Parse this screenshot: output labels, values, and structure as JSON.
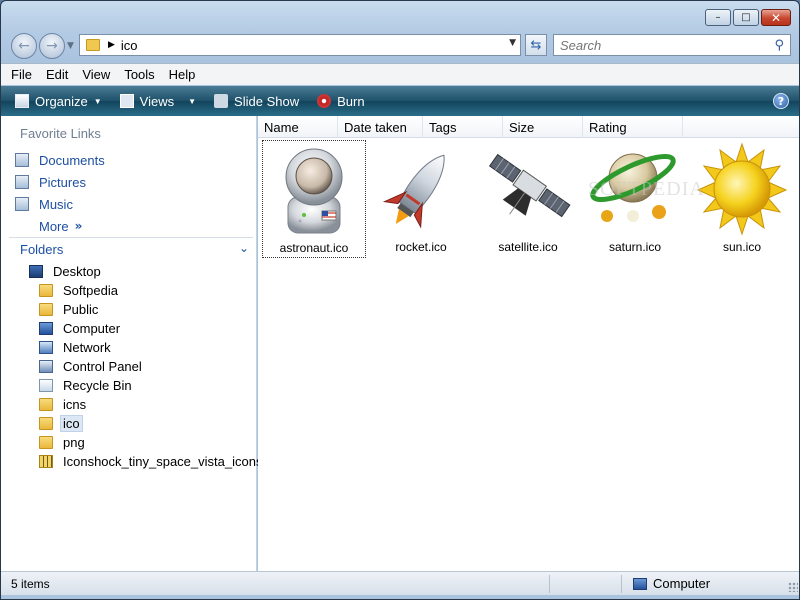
{
  "window": {
    "caption_buttons": {
      "minimize": "–",
      "maximize": "□",
      "close": "✕"
    }
  },
  "address": {
    "path": "ico",
    "back_icon": "←",
    "forward_icon": "→",
    "refresh_icon": "⇆"
  },
  "search": {
    "placeholder": "Search"
  },
  "menu": {
    "items": [
      "File",
      "Edit",
      "View",
      "Tools",
      "Help"
    ]
  },
  "commandbar": {
    "organize": "Organize",
    "views": "Views",
    "slideshow": "Slide Show",
    "burn": "Burn",
    "help": "?"
  },
  "nav": {
    "favorites_title": "Favorite Links",
    "favorites": [
      "Documents",
      "Pictures",
      "Music"
    ],
    "more": "More",
    "more_chevron": "»",
    "folders_title": "Folders",
    "folders_chevron": "⌄",
    "tree": [
      {
        "label": "Desktop",
        "icon": "desktop-icon"
      },
      {
        "label": "Softpedia",
        "icon": "folder-icon"
      },
      {
        "label": "Public",
        "icon": "folder-icon"
      },
      {
        "label": "Computer",
        "icon": "computer-icon"
      },
      {
        "label": "Network",
        "icon": "network-icon"
      },
      {
        "label": "Control Panel",
        "icon": "control-panel-icon"
      },
      {
        "label": "Recycle Bin",
        "icon": "recycle-bin-icon"
      },
      {
        "label": "icns",
        "icon": "folder-icon"
      },
      {
        "label": "ico",
        "icon": "folder-icon"
      },
      {
        "label": "png",
        "icon": "folder-icon"
      },
      {
        "label": "Iconshock_tiny_space_vista_icons.zip",
        "icon": "zip-folder-icon"
      }
    ]
  },
  "columns": [
    "Name",
    "Date taken",
    "Tags",
    "Size",
    "Rating"
  ],
  "files": [
    {
      "name": "astronaut.ico",
      "icon": "astronaut-icon"
    },
    {
      "name": "rocket.ico",
      "icon": "rocket-icon"
    },
    {
      "name": "satellite.ico",
      "icon": "satellite-icon"
    },
    {
      "name": "saturn.ico",
      "icon": "saturn-icon"
    },
    {
      "name": "sun.ico",
      "icon": "sun-icon"
    }
  ],
  "watermark": "SOFTPEDIA",
  "status": {
    "count": "5 items",
    "location": "Computer"
  }
}
